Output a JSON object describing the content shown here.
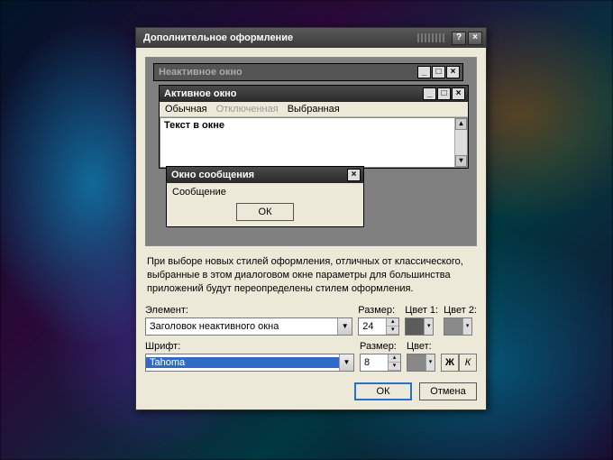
{
  "dialog": {
    "title": "Дополнительное оформление",
    "help_label": "?",
    "close_label": "×"
  },
  "preview": {
    "inactive_title": "Неактивное окно",
    "active_title": "Активное окно",
    "menu": {
      "normal": "Обычная",
      "disabled": "Отключенная",
      "selected": "Выбранная"
    },
    "text_in_window": "Текст в окне",
    "message_window_title": "Окно сообщения",
    "message_text": "Сообщение",
    "ok_label": "ОК",
    "minimize": "_",
    "maximize": "□",
    "close": "×",
    "scroll_up": "▴",
    "scroll_down": "▾"
  },
  "note": "При выборе новых стилей оформления, отличных от классического, выбранные в этом диалоговом окне параметры для большинства приложений будут переопределены стилем оформления.",
  "labels": {
    "element": "Элемент:",
    "size": "Размер:",
    "color1": "Цвет 1:",
    "color2": "Цвет 2:",
    "font": "Шрифт:",
    "color": "Цвет:"
  },
  "values": {
    "element": "Заголовок неактивного окна",
    "size1": "24",
    "font": "Tahoma",
    "size2": "8",
    "bold": "Ж",
    "italic": "К",
    "color1": "#5c5c5c",
    "color2": "#8a8a8a",
    "font_color": "#888888"
  },
  "buttons": {
    "ok": "ОК",
    "cancel": "Отмена"
  },
  "dropdown_glyph": "▼"
}
